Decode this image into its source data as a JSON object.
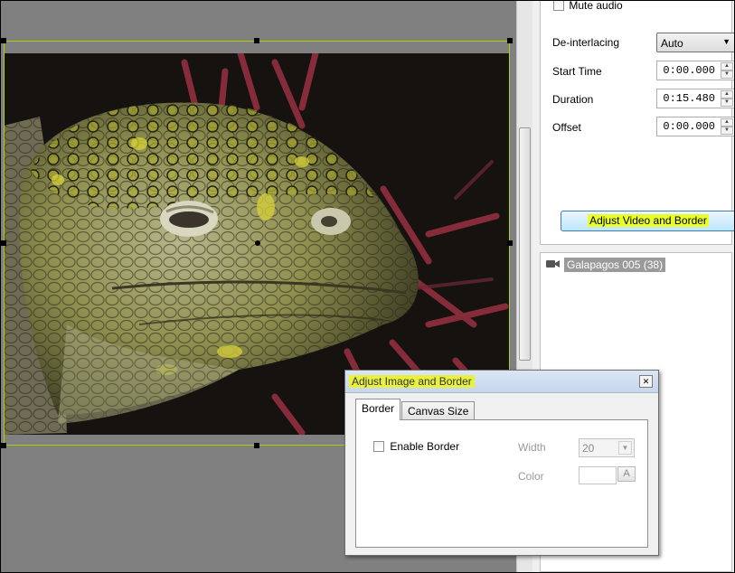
{
  "properties": {
    "mute_audio_label": "Mute audio",
    "deinterlacing_label": "De-interlacing",
    "deinterlacing_value": "Auto",
    "start_time_label": "Start Time",
    "start_time_value": "0:00.000",
    "duration_label": "Duration",
    "duration_value": "0:15.480",
    "offset_label": "Offset",
    "offset_value": "0:00.000",
    "adjust_button_label": "Adjust Video and Border"
  },
  "media_list": {
    "items": [
      {
        "label": "Galapagos 005 (38)",
        "icon": "video-camera-icon"
      }
    ]
  },
  "dialog": {
    "title": "Adjust Image and Border",
    "tabs": [
      {
        "label": "Border",
        "active": true
      },
      {
        "label": "Canvas Size",
        "active": false
      }
    ],
    "enable_border_label": "Enable Border",
    "width_label": "Width",
    "width_value": "20",
    "color_label": "Color",
    "color_button_glyph": "A"
  },
  "colors": {
    "selection_border": "#a8d400",
    "highlight": "#eaff2a",
    "button_gradient_top": "#eaf6fd",
    "button_gradient_bottom": "#bee6fd"
  }
}
